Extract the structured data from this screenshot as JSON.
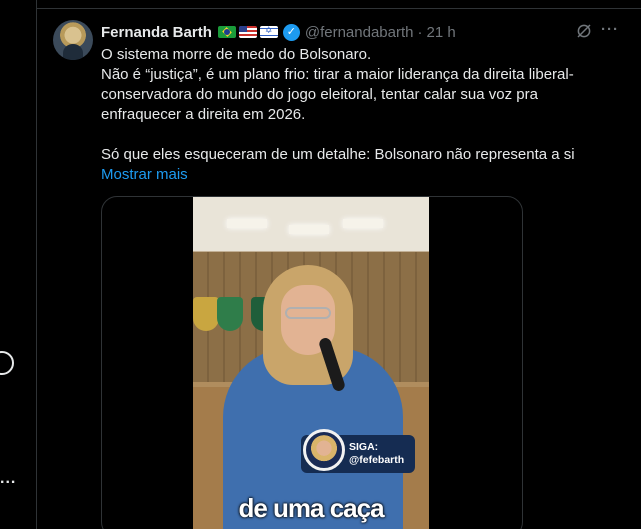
{
  "tweet": {
    "author_name": "Fernanda Barth",
    "handle": "@fernandabarth",
    "separator": "·",
    "time": "21 h",
    "text_lines": [
      "O sistema morre de medo do Bolsonaro.",
      "Não é “justiça”, é um plano frio: tirar a maior liderança da direita liberal-",
      "conservadora do mundo do jogo eleitoral, tentar calar sua voz pra",
      "enfraquecer a direita em 2026."
    ],
    "text_line_2": "Só que eles esqueceram de um detalhe: Bolsonaro não representa a si",
    "show_more": "Mostrar mais",
    "flags": [
      "brazil-flag",
      "usa-flag",
      "israel-flag"
    ],
    "icons": {
      "verified": "verified-badge-icon",
      "grok": "grok-icon",
      "more": "more-icon"
    },
    "colors": {
      "link": "#1d9bf0",
      "secondary": "#71767b",
      "text": "#e7e9ea",
      "background": "#000000"
    }
  },
  "video": {
    "follow_label": "SIGA:",
    "follow_handle": "@fefebarth",
    "caption": "de uma caça"
  },
  "sidebar_fragment": {
    "more_label": "..."
  }
}
